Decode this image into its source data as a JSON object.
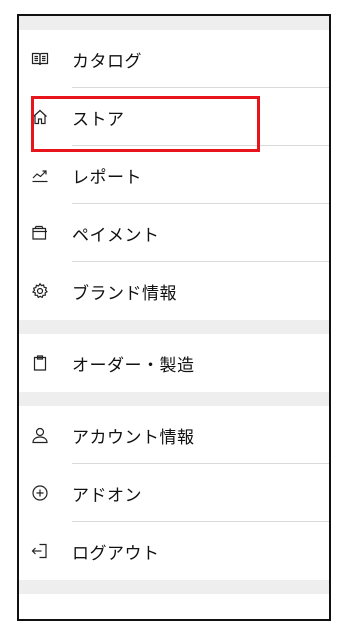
{
  "colors": {
    "highlight": "#e8141c",
    "section_gap": "#eeeeee",
    "divider": "#d9d9d9",
    "text": "#111111"
  },
  "menu": {
    "sections": [
      {
        "items": [
          {
            "label": "カタログ",
            "icon": "book-icon"
          },
          {
            "label": "ストア",
            "icon": "home-icon",
            "highlighted": true
          },
          {
            "label": "レポート",
            "icon": "chart-line-icon"
          },
          {
            "label": "ペイメント",
            "icon": "wallet-icon"
          },
          {
            "label": "ブランド情報",
            "icon": "gear-icon"
          }
        ]
      },
      {
        "items": [
          {
            "label": "オーダー・製造",
            "icon": "clipboard-icon"
          }
        ]
      },
      {
        "items": [
          {
            "label": "アカウント情報",
            "icon": "user-icon"
          },
          {
            "label": "アドオン",
            "icon": "plus-circle-icon"
          },
          {
            "label": "ログアウト",
            "icon": "logout-icon"
          }
        ]
      }
    ]
  }
}
